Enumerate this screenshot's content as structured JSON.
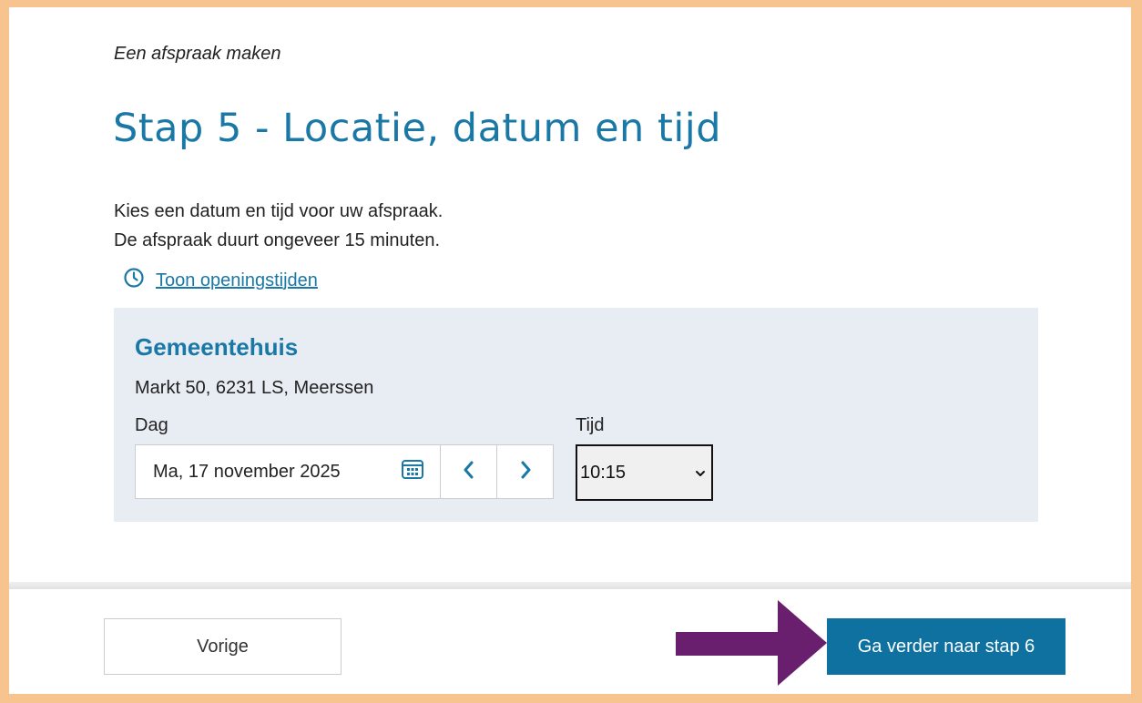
{
  "header": {
    "eyebrow": "Een afspraak maken",
    "title": "Stap 5 - Locatie, datum en tijd"
  },
  "intro": {
    "line1": "Kies een datum en tijd voor uw afspraak.",
    "line2": "De afspraak duurt ongeveer 15 minuten."
  },
  "hours_link": {
    "icon": "clock-icon",
    "label": "Toon openingstijden"
  },
  "location": {
    "name": "Gemeentehuis",
    "address": "Markt 50, 6231 LS, Meerssen",
    "day_label": "Dag",
    "day_value": "Ma, 17 november 2025",
    "time_label": "Tijd",
    "time_value": "10:15"
  },
  "footer": {
    "prev_label": "Vorige",
    "next_label": "Ga verder naar stap 6"
  },
  "colors": {
    "accent": "#1a78a6",
    "primary_button": "#0f71a0",
    "panel_bg": "#e8edf4",
    "frame_border": "#f7c48f",
    "annotation_arrow": "#6a1f6e"
  }
}
